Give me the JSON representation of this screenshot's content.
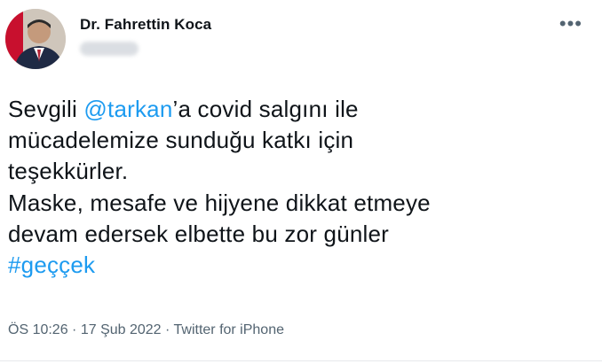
{
  "author": {
    "display_name": "Dr. Fahrettin Koca",
    "handle_blurred": true
  },
  "header": {
    "more_label": "•••",
    "more_icon": "more-horizontal-icon"
  },
  "tweet": {
    "line1_pre": "Sevgili ",
    "mention": "@tarkan",
    "line1_post": "’a covid salgını ile",
    "line2": "mücadelemize sunduğu katkı için",
    "line3": "teşekkürler.",
    "line4": "Maske, mesafe ve hijyene dikkat etmeye",
    "line5": "devam edersek elbette bu zor günler",
    "hashtag": "#geççek"
  },
  "meta": {
    "timestamp": "ÖS 10:26 · 17 Şub 2022 · Twitter for iPhone"
  },
  "colors": {
    "link": "#1d9bf0",
    "text": "#0f1419",
    "secondary": "#536471"
  }
}
